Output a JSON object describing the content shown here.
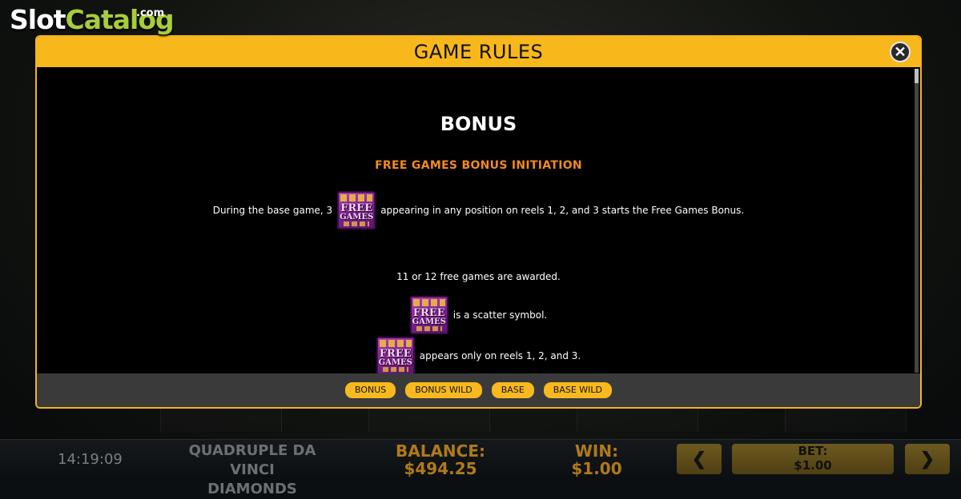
{
  "watermark": {
    "brand_part1": "Slot",
    "brand_part2": "Catalog",
    "brand_suffix": ".com"
  },
  "modal": {
    "title": "GAME RULES",
    "close_icon": "close-icon",
    "section_title": "BONUS",
    "section_subtitle": "FREE GAMES BONUS INITIATION",
    "symbol": {
      "line1": "FREE",
      "line2": "GAMES"
    },
    "rules": {
      "line1_before": "During the base game, 3",
      "line1_after": "appearing in any position on reels 1, 2, and 3 starts the Free Games Bonus.",
      "line2": "11 or 12 free games are awarded.",
      "line3_after": "is a scatter symbol.",
      "line4_after": "appears only on reels 1, 2, and 3."
    },
    "tabs": [
      "BONUS",
      "BONUS WILD",
      "BASE",
      "BASE WILD"
    ]
  },
  "statusbar": {
    "clock": "14:19:09",
    "game_name_line1": "QUADRUPLE DA VINCI",
    "game_name_line2": "DIAMONDS",
    "balance_label": "BALANCE:",
    "balance_value": "$494.25",
    "win_label": "WIN:",
    "win_value": "$1.00",
    "bet_label": "BET:",
    "bet_value": "$1.00",
    "prev_icon": "chevron-left-icon",
    "next_icon": "chevron-right-icon"
  },
  "colors": {
    "accent": "#f8b81c",
    "subtitle": "#f28a1f",
    "footer_bar": "#3a3a3a",
    "watermark_green": "#a8cc3a"
  }
}
